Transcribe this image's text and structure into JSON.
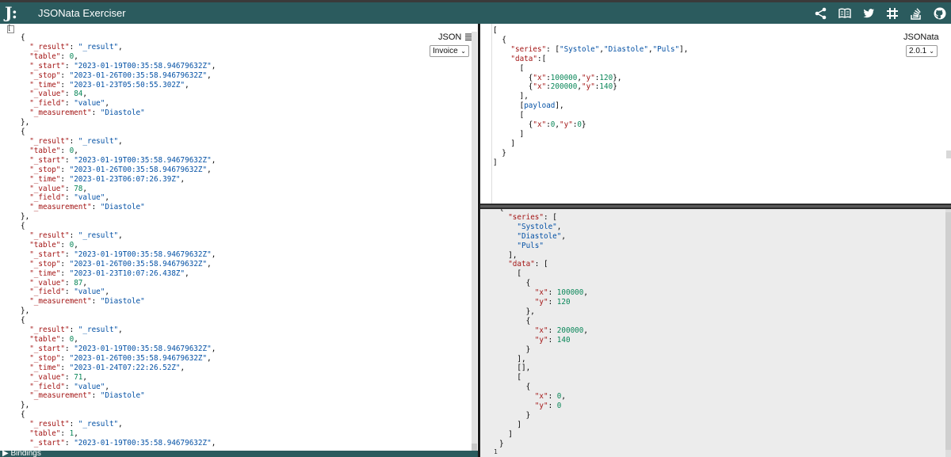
{
  "app": {
    "logo": "J:",
    "title": "JSONata Exerciser",
    "icons": [
      "share-icon",
      "book-icon",
      "twitter-icon",
      "slack-icon",
      "stackoverflow-icon",
      "github-icon"
    ]
  },
  "input_pane": {
    "lang_label": "JSON",
    "select_value": "Invoice",
    "gutter_bracket": "[",
    "records": [
      {
        "result": "\"_result\"",
        "table": "0",
        "start": "\"2023-01-19T00:35:58.94679632Z\"",
        "stop": "\"2023-01-26T00:35:58.94679632Z\"",
        "time": "\"2023-01-23T05:50:55.302Z\"",
        "value": "84",
        "field": "\"value\"",
        "measurement": "\"Diastole\""
      },
      {
        "result": "\"_result\"",
        "table": "0",
        "start": "\"2023-01-19T00:35:58.94679632Z\"",
        "stop": "\"2023-01-26T00:35:58.94679632Z\"",
        "time": "\"2023-01-23T06:07:26.39Z\"",
        "value": "78",
        "field": "\"value\"",
        "measurement": "\"Diastole\""
      },
      {
        "result": "\"_result\"",
        "table": "0",
        "start": "\"2023-01-19T00:35:58.94679632Z\"",
        "stop": "\"2023-01-26T00:35:58.94679632Z\"",
        "time": "\"2023-01-23T10:07:26.438Z\"",
        "value": "87",
        "field": "\"value\"",
        "measurement": "\"Diastole\""
      },
      {
        "result": "\"_result\"",
        "table": "0",
        "start": "\"2023-01-19T00:35:58.94679632Z\"",
        "stop": "\"2023-01-26T00:35:58.94679632Z\"",
        "time": "\"2023-01-24T07:22:26.52Z\"",
        "value": "71",
        "field": "\"value\"",
        "measurement": "\"Diastole\""
      },
      {
        "result": "\"_result\"",
        "table": "1",
        "start": "\"2023-01-19T00:35:58.94679632Z\""
      }
    ],
    "bindings_label": "▶ Bindings"
  },
  "expression_pane": {
    "lang_label": "JSONata",
    "version": "2.0.1",
    "gutter_bracket": "[",
    "lines": [
      "[",
      "  {",
      "    \"series\": [\"Systole\",\"Diastole\",\"Puls\"],",
      "    \"data\":[",
      "      [",
      "        {\"x\":100000,\"y\":120},",
      "        {\"x\":200000,\"y\":140}",
      "      ],",
      "      [payload],",
      "      [",
      "        {\"x\":0,\"y\":0}",
      "      ]",
      "    ]",
      "  }",
      "]"
    ]
  },
  "result_pane": {
    "lines": [
      "{",
      "  \"series\": [",
      "    \"Systole\",",
      "    \"Diastole\",",
      "    \"Puls\"",
      "  ],",
      "  \"data\": [",
      "    [",
      "      {",
      "        \"x\": 100000,",
      "        \"y\": 120",
      "      },",
      "      {",
      "        \"x\": 200000,",
      "        \"y\": 140",
      "      }",
      "    ],",
      "    [],",
      "    [",
      "      {",
      "        \"x\": 0,",
      "        \"y\": 0",
      "      }",
      "    ]",
      "  ]",
      "}"
    ],
    "gutter_bottom": "1"
  }
}
